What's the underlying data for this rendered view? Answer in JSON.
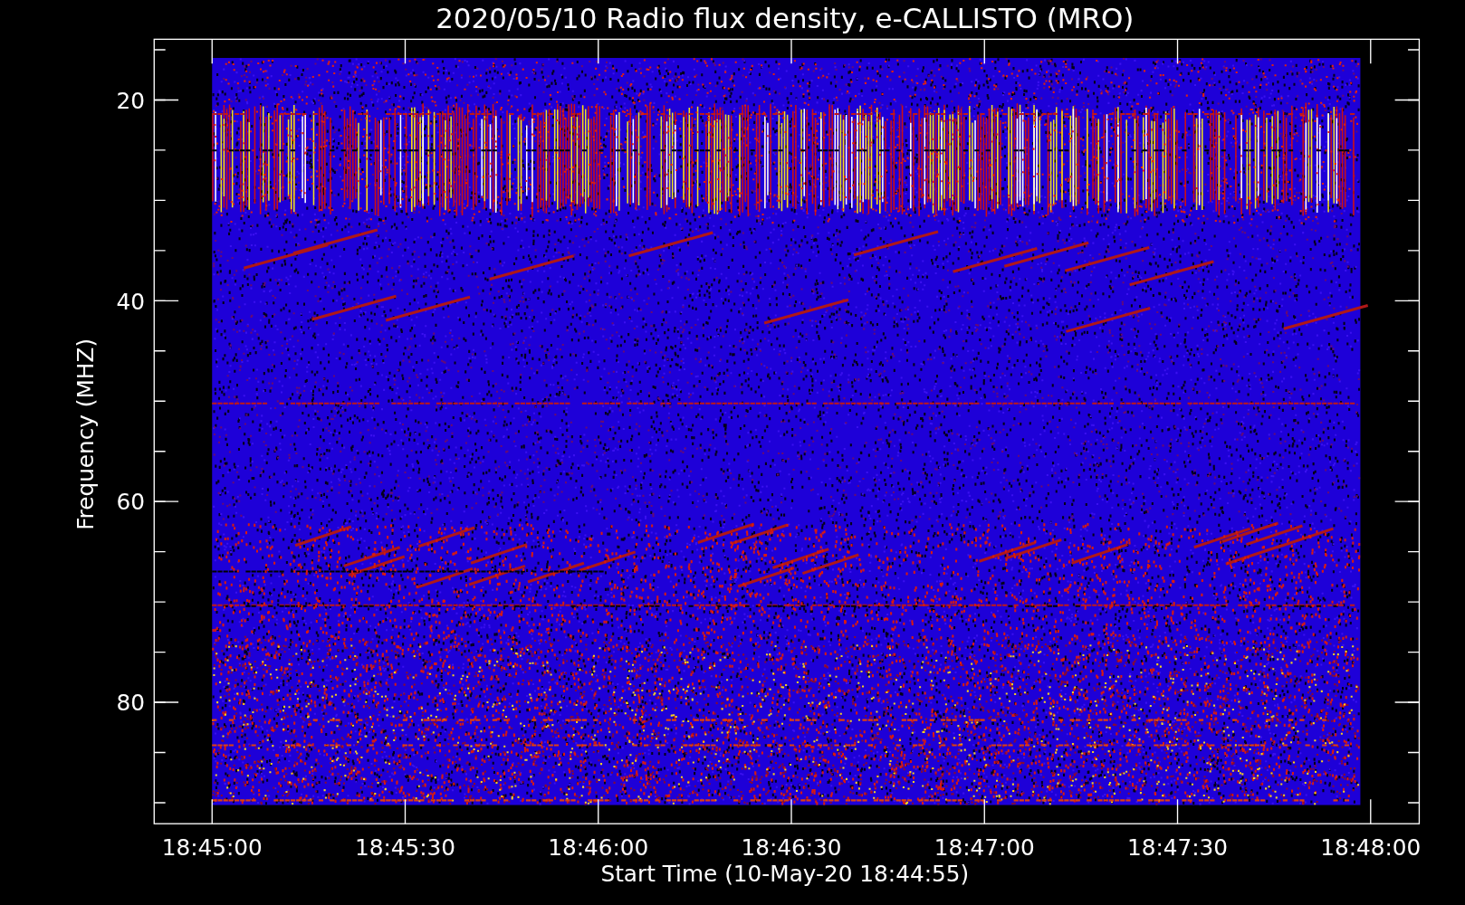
{
  "plot": {
    "title": "2020/05/10  Radio flux density, e-CALLISTO (MRO)",
    "xlabel": "Start Time (10-May-20 18:44:55)",
    "ylabel": "Frequency (MHZ)",
    "xticks": [
      "18:45:00",
      "18:45:30",
      "18:46:00",
      "18:46:30",
      "18:47:00",
      "18:47:30",
      "18:48:00"
    ],
    "yticks": [
      "20",
      "40",
      "60",
      "80"
    ]
  }
}
